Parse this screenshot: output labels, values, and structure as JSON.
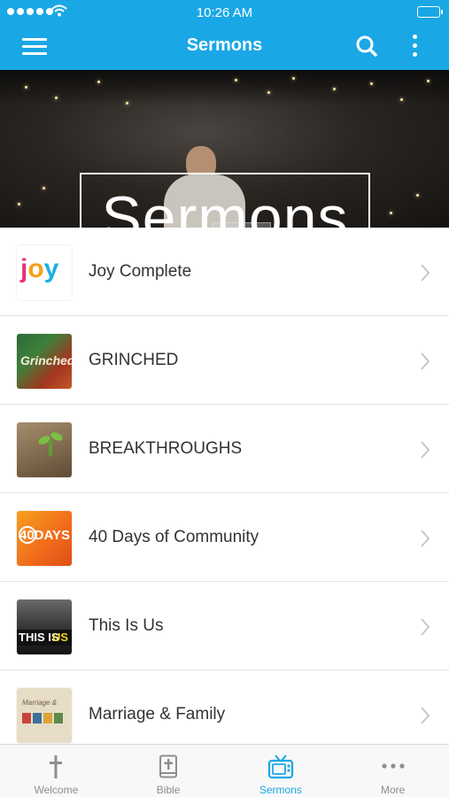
{
  "status_bar": {
    "time": "10:26 AM"
  },
  "nav": {
    "title": "Sermons"
  },
  "hero": {
    "title": "Sermons"
  },
  "sermon_series": [
    {
      "title": "Joy Complete",
      "thumb_text": "JOY"
    },
    {
      "title": "GRINCHED",
      "thumb_text": "Grinched"
    },
    {
      "title": "BREAKTHROUGHS",
      "thumb_text": ""
    },
    {
      "title": "40 Days of Community",
      "thumb_text": "40DAYS"
    },
    {
      "title": "This Is Us",
      "thumb_text_1": "THIS IS",
      "thumb_text_2": "US"
    },
    {
      "title": "Marriage & Family",
      "thumb_text": "Marriage &"
    }
  ],
  "tabs": [
    {
      "label": "Welcome",
      "icon": "cross-icon",
      "active": false
    },
    {
      "label": "Bible",
      "icon": "bible-icon",
      "active": false
    },
    {
      "label": "Sermons",
      "icon": "tv-icon",
      "active": true
    },
    {
      "label": "More",
      "icon": "more-icon",
      "active": false
    }
  ],
  "colors": {
    "accent": "#1aa7e6",
    "tab_inactive": "#8e8e8e"
  }
}
